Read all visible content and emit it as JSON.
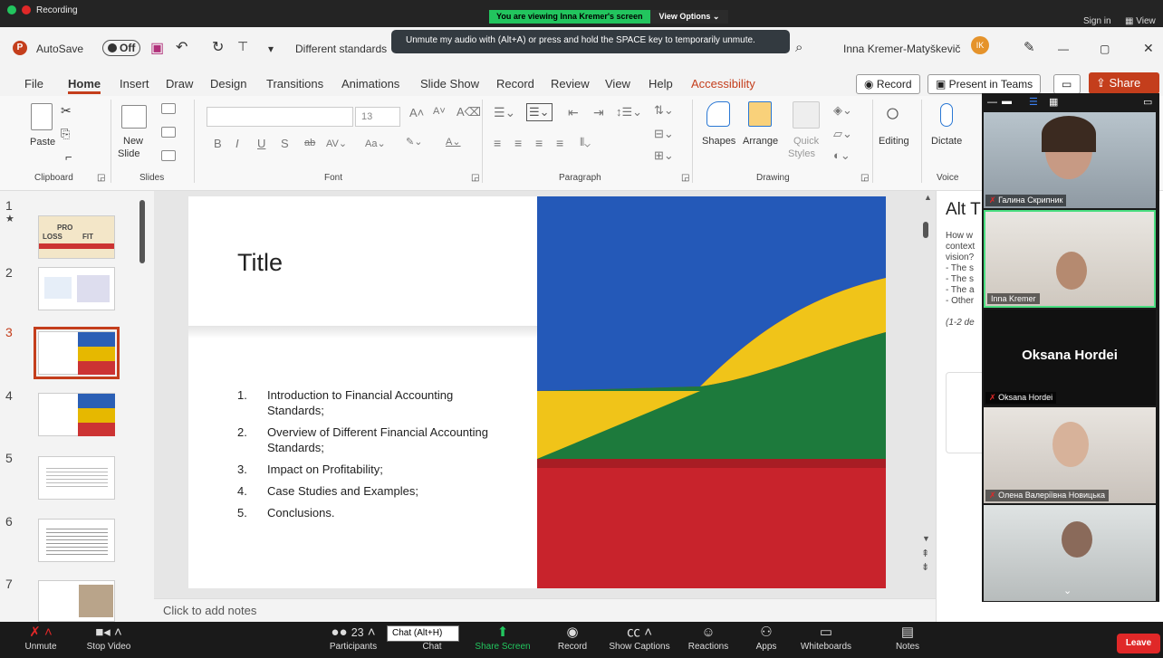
{
  "zoom": {
    "recording": "Recording",
    "share_banner": "You are viewing Inna Kremer's screen",
    "view_options": "View Options",
    "sign_in": "Sign in",
    "view": "View",
    "tooltip": "Unmute my audio with (Alt+A) or press and hold the SPACE key to temporarily unmute.",
    "bottom": {
      "unmute": "Unmute",
      "stop_video": "Stop Video",
      "participants": "Participants",
      "participants_count": "23",
      "chat": "Chat",
      "chat_tooltip": "Chat (Alt+H)",
      "share_screen": "Share Screen",
      "record": "Record",
      "show_captions": "Show Captions",
      "reactions": "Reactions",
      "apps": "Apps",
      "whiteboards": "Whiteboards",
      "notes": "Notes",
      "leave": "Leave"
    },
    "participants": [
      {
        "name": "Галина Скрипник"
      },
      {
        "name": "Inna Kremer"
      },
      {
        "name": "Oksana Hordei",
        "label": "Oksana Hordei"
      },
      {
        "name": "Олена Валеріївна Новицька"
      }
    ]
  },
  "ppt": {
    "autosave": "AutoSave",
    "autosave_state": "Off",
    "doc_title": "Different standards",
    "user": "Inna Kremer-Matyškevič",
    "user_initials": "IK",
    "menus": [
      "File",
      "Home",
      "Insert",
      "Draw",
      "Design",
      "Transitions",
      "Animations",
      "Slide Show",
      "Record",
      "Review",
      "View",
      "Help",
      "Accessibility"
    ],
    "record_btn": "Record",
    "present_teams": "Present in Teams",
    "share_btn": "Share",
    "ribbon": {
      "paste": "Paste",
      "new_slide": "New",
      "new_slide2": "Slide",
      "font_size": "13",
      "shapes": "Shapes",
      "arrange": "Arrange",
      "quick": "Quick",
      "styles": "Styles",
      "editing": "Editing",
      "dictate": "Dictate",
      "groups": {
        "clipboard": "Clipboard",
        "slides": "Slides",
        "font": "Font",
        "paragraph": "Paragraph",
        "drawing": "Drawing",
        "voice": "Voice"
      }
    },
    "thumb_numbers": [
      "1",
      "2",
      "3",
      "4",
      "5",
      "6",
      "7"
    ],
    "slide": {
      "title": "Title",
      "items": [
        {
          "n": "1.",
          "text": "Introduction to Financial Accounting Standards;"
        },
        {
          "n": "2.",
          "text": "Overview of Different Financial Accounting Standards;"
        },
        {
          "n": "3.",
          "text": "Impact on Profitability;"
        },
        {
          "n": "4.",
          "text": "Case Studies and Examples;"
        },
        {
          "n": "5.",
          "text": "Conclusions."
        }
      ]
    },
    "notes_placeholder": "Click to add notes",
    "alt": {
      "title": "Alt T",
      "lines": [
        "How w",
        "context",
        "vision?",
        "- The s",
        "- The s",
        "- The a",
        "- Other"
      ],
      "footer": "(1-2 de"
    },
    "thumb1_text": {
      "l": "LOSS",
      "p": "PRO",
      "f": "FIT"
    }
  }
}
